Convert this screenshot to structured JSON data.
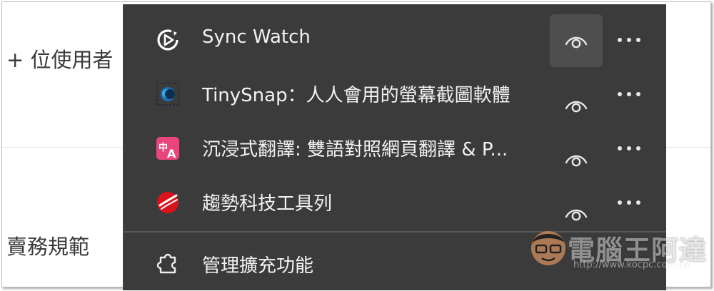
{
  "background": {
    "text_top": "+ 位使用者",
    "text_bottom": "賣務規範"
  },
  "extensions": [
    {
      "name": "Sync Watch",
      "icon": "sync-watch-icon",
      "pinned_highlight": true
    },
    {
      "name": "TinySnap：人人會用的螢幕截圖軟體",
      "icon": "tinysnap-icon",
      "pinned_highlight": false
    },
    {
      "name": "沉浸式翻譯: 雙語對照網頁翻譯 & P...",
      "icon": "immersive-translate-icon",
      "pinned_highlight": false
    },
    {
      "name": "趨勢科技工具列",
      "icon": "trend-micro-icon",
      "pinned_highlight": false
    }
  ],
  "manage": {
    "label": "管理擴充功能",
    "icon": "puzzle-icon"
  },
  "watermark": {
    "title": "電腦王阿達",
    "url": "http://www.kocpc.com.tw"
  },
  "colors": {
    "menu_bg": "#3b3b3b",
    "text": "#f2f2f2",
    "translate_pink": "#e8457a",
    "trend_red": "#d9121b"
  }
}
